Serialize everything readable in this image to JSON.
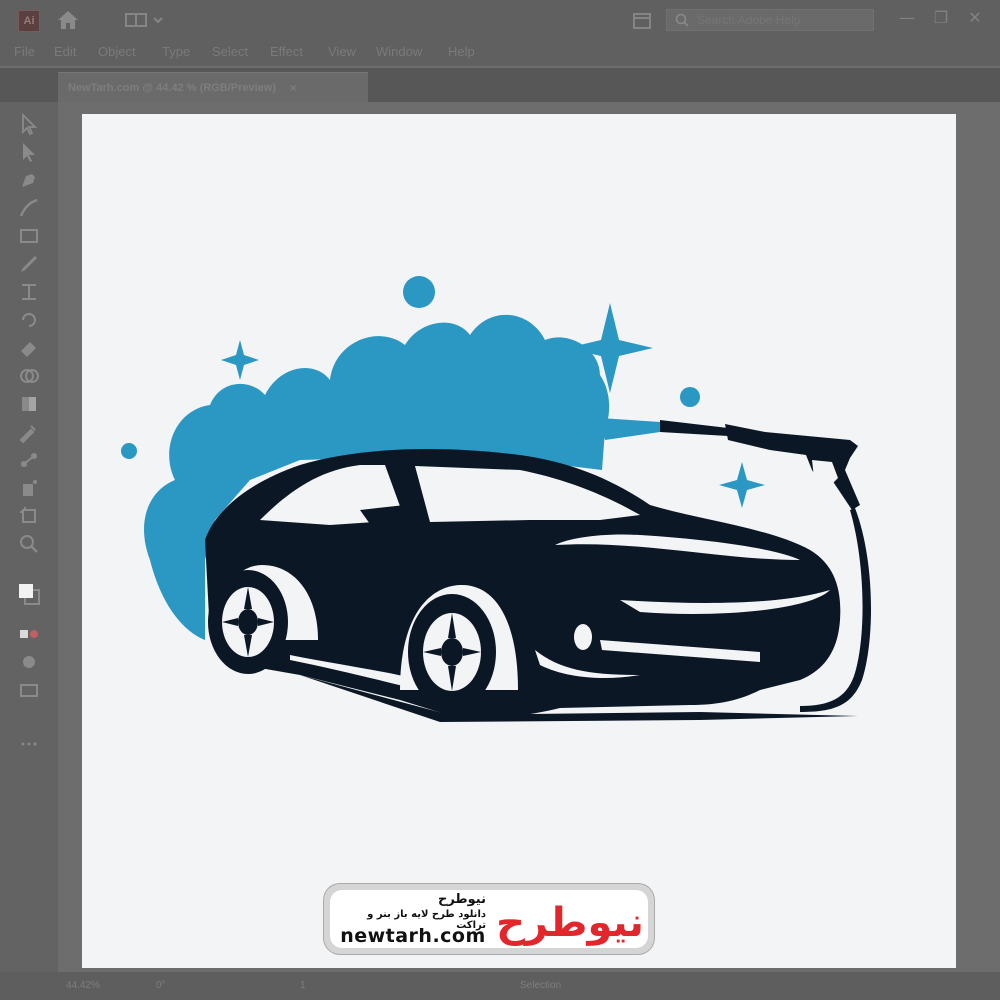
{
  "app": {
    "icon_label": "Ai"
  },
  "search": {
    "placeholder": "Search Adobe Help"
  },
  "menu": [
    "File",
    "Edit",
    "Object",
    "Type",
    "Select",
    "Effect",
    "View",
    "Window",
    "Help"
  ],
  "document_tab": {
    "title": "NewTarh.com @ 44.42 % (RGB/Preview)",
    "close": "×"
  },
  "window_controls": {
    "minimize": "—",
    "restore": "❐",
    "close": "✕"
  },
  "status": {
    "zoom": "44.42%",
    "rotation": "0°",
    "artboard": "1",
    "tool": "Selection"
  },
  "tools": [
    "selection-tool-icon",
    "direct-selection-tool-icon",
    "pen-tool-icon",
    "curvature-tool-icon",
    "rectangle-tool-icon",
    "paintbrush-tool-icon",
    "width-tool-icon",
    "rotate-tool-icon",
    "eraser-tool-icon",
    "shape-builder-tool-icon",
    "gradient-tool-icon",
    "eyedropper-tool-icon",
    "blend-tool-icon",
    "symbol-sprayer-tool-icon",
    "artboard-tool-icon",
    "zoom-tool-icon"
  ],
  "logo": {
    "colors": {
      "foam": "#2b97c3",
      "car": "#0c1726",
      "sparkle": "#2b97c3"
    }
  },
  "watermark": {
    "site_name_fa": "نیوطرح",
    "tagline_fa": "دانلود طرح لایه باز بنر و تراکت",
    "url": "newtarh.com",
    "logo_text_fa": "نیوطرح",
    "colors": {
      "red": "#e3262b",
      "blue": "#1d64b1"
    }
  }
}
